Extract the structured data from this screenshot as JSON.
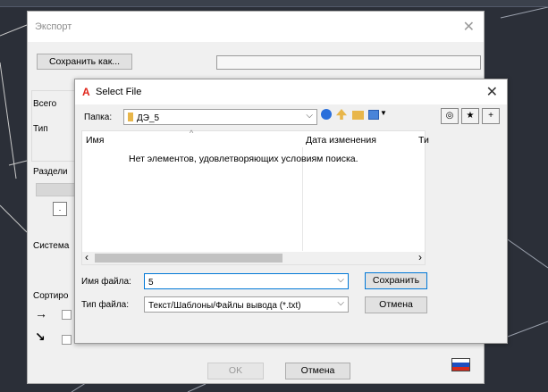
{
  "export_dialog": {
    "title": "Экспорт",
    "save_as_label": "Сохранить как...",
    "labels": {
      "total": "Всего",
      "type": "Тип",
      "split": "Раздели",
      "system": "Система",
      "sort": "Сортиро"
    },
    "small_box_text": ".",
    "ok_label": "OK",
    "cancel_label": "Отмена",
    "flag_colors": [
      "#ffffff",
      "#1f4fc0",
      "#d52b1e"
    ]
  },
  "select_file": {
    "title": "Select File",
    "folder_label": "Папка:",
    "folder_value": "ДЭ_5",
    "columns": [
      "Имя",
      "Дата изменения",
      "Ти"
    ],
    "empty_message": "Нет элементов, удовлетворяющих условиям поиска.",
    "filename_label": "Имя файла:",
    "filename_value": "5",
    "filetype_label": "Тип файла:",
    "filetype_value": "Текст/Шаблоны/Файлы вывода (*.txt)",
    "save_label": "Сохранить",
    "cancel_label": "Отмена"
  },
  "icons": {
    "close": "✕",
    "dropdown": "⌵",
    "scroll_left": "‹",
    "scroll_right": "›",
    "sort_up": "^",
    "arrow_right": "→",
    "arrow_diag": "↘"
  },
  "colors": {
    "accent": "#0078d7",
    "autocad_red": "#e0261b",
    "background": "#2b2f38"
  }
}
